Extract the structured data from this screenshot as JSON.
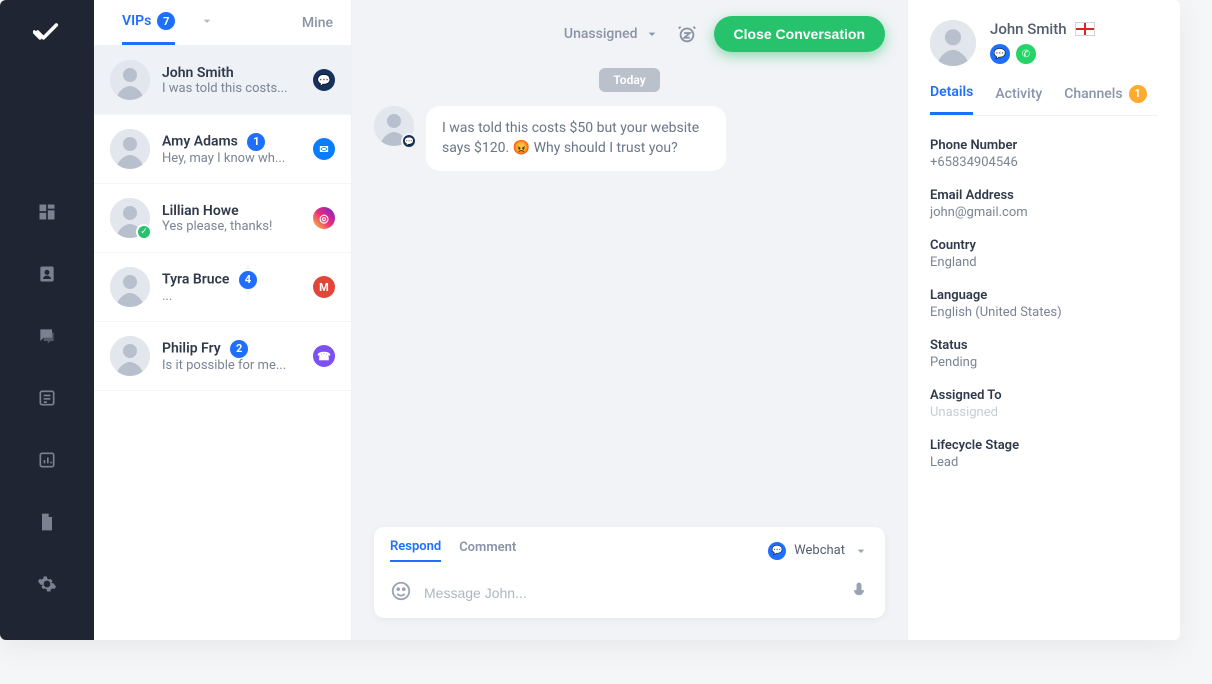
{
  "nav": {
    "logo": "checkmark"
  },
  "tabs": {
    "vips_label": "VIPs",
    "vips_count": "7",
    "mine_label": "Mine"
  },
  "conversations": [
    {
      "name": "John Smith",
      "preview": "I was told this costs...",
      "channel": "webchat",
      "badge": null,
      "active": true,
      "verified": false
    },
    {
      "name": "Amy Adams",
      "preview": "Hey, may I know wh...",
      "channel": "messenger",
      "badge": "1",
      "active": false,
      "verified": false
    },
    {
      "name": "Lillian Howe",
      "preview": "Yes please, thanks!",
      "channel": "instagram",
      "badge": null,
      "active": false,
      "verified": true
    },
    {
      "name": "Tyra Bruce",
      "preview": "...",
      "channel": "gmail",
      "badge": "4",
      "active": false,
      "verified": false
    },
    {
      "name": "Philip Fry",
      "preview": "Is it possible for me...",
      "channel": "viber",
      "badge": "2",
      "active": false,
      "verified": false
    }
  ],
  "chat": {
    "assignee": "Unassigned",
    "close_label": "Close Conversation",
    "day_divider": "Today",
    "message_text": "I was told this costs $50 but your website says $120. 😡 Why should I trust you?",
    "respond_tab": "Respond",
    "comment_tab": "Comment",
    "channel_label": "Webchat",
    "input_placeholder": "Message John..."
  },
  "details": {
    "name": "John Smith",
    "tabs": {
      "details": "Details",
      "activity": "Activity",
      "channels": "Channels",
      "channels_count": "1"
    },
    "fields": {
      "phone_label": "Phone Number",
      "phone_value": "+65834904546",
      "email_label": "Email Address",
      "email_value": "john@gmail.com",
      "country_label": "Country",
      "country_value": "England",
      "language_label": "Language",
      "language_value": "English (United States)",
      "status_label": "Status",
      "status_value": "Pending",
      "assigned_label": "Assigned To",
      "assigned_value": "Unassigned",
      "lifecycle_label": "Lifecycle Stage",
      "lifecycle_value": "Lead"
    }
  }
}
